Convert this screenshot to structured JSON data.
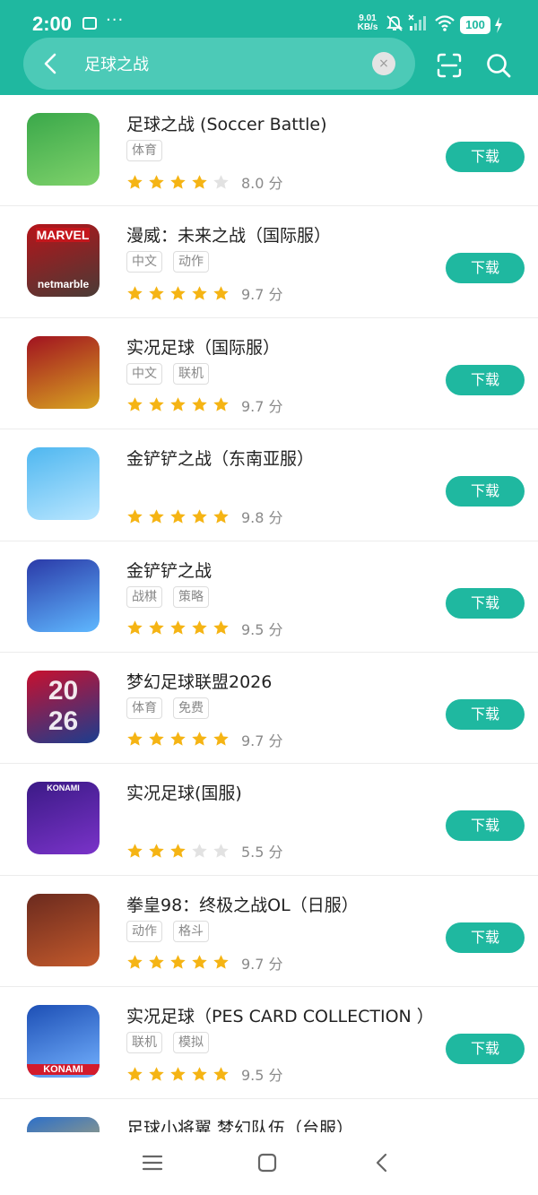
{
  "status_bar": {
    "time": "2:00",
    "dots": "···",
    "speed_value": "9.01",
    "speed_unit": "KB/s",
    "battery": "100"
  },
  "search": {
    "value": "足球之战",
    "clear_glyph": "×"
  },
  "apps": [
    {
      "name": "足球之战 (Soccer Battle)",
      "tags": [
        "体育"
      ],
      "stars": 4,
      "score": "8.0 分",
      "download_label": "下载",
      "icon": "soccer-battle-icon",
      "icon_colors": [
        "#3aa84a",
        "#7fd26b"
      ]
    },
    {
      "name": "漫威：未来之战（国际服）",
      "tags": [
        "中文",
        "动作"
      ],
      "stars": 5,
      "score": "9.7 分",
      "download_label": "下载",
      "icon": "marvel-future-fight-icon",
      "icon_colors": [
        "#b5141a",
        "#4a3b36"
      ]
    },
    {
      "name": "实况足球（国际服）",
      "tags": [
        "中文",
        "联机"
      ],
      "stars": 5,
      "score": "9.7 分",
      "download_label": "下载",
      "icon": "efootball-global-icon",
      "icon_colors": [
        "#a11220",
        "#d8a521"
      ]
    },
    {
      "name": "金铲铲之战（东南亚服）",
      "tags": [],
      "stars": 5,
      "score": "9.8 分",
      "download_label": "下载",
      "icon": "penguin-sea-icon",
      "icon_colors": [
        "#4fb7f0",
        "#b9e6ff"
      ]
    },
    {
      "name": "金铲铲之战",
      "tags": [
        "战棋",
        "策略"
      ],
      "stars": 5,
      "score": "9.5 分",
      "download_label": "下载",
      "icon": "penguin-cn-icon",
      "icon_colors": [
        "#2b3aa8",
        "#5fb8ff"
      ]
    },
    {
      "name": "梦幻足球联盟2026",
      "tags": [
        "体育",
        "免费"
      ],
      "stars": 5,
      "score": "9.7 分",
      "download_label": "下载",
      "icon": "dream-league-icon",
      "icon_colors": [
        "#c8102e",
        "#1b3d8f"
      ]
    },
    {
      "name": "实况足球(国服)",
      "tags": [],
      "stars": 3,
      "score": "5.5 分",
      "download_label": "下载",
      "icon": "efootball-cn-icon",
      "icon_colors": [
        "#3b1a86",
        "#7a33c9"
      ]
    },
    {
      "name": "拳皇98：终极之战OL（日服）",
      "tags": [
        "动作",
        "格斗"
      ],
      "stars": 5,
      "score": "9.7 分",
      "download_label": "下载",
      "icon": "kof98-icon",
      "icon_colors": [
        "#6b2a1e",
        "#c35a2c"
      ]
    },
    {
      "name": "实况足球（PES CARD COLLECTION ）",
      "tags": [
        "联机",
        "模拟"
      ],
      "stars": 5,
      "score": "9.5 分",
      "download_label": "下载",
      "icon": "pes-card-icon",
      "icon_colors": [
        "#1d4fb5",
        "#74b2ff"
      ]
    },
    {
      "name": "足球小将翼 梦幻队伍（台服）",
      "tags": [],
      "stars": 0,
      "score": "",
      "download_label": "",
      "icon": "captain-tsubasa-icon",
      "icon_colors": [
        "#2c6fc9",
        "#f0c24b"
      ]
    }
  ],
  "icon_text": {
    "marvel": "MARVEL",
    "netmarble": "netmarble",
    "konami": "KONAMI",
    "year_top": "20",
    "year_bottom": "26"
  },
  "colors": {
    "accent": "#1fb8a0",
    "star_on": "#f5b414",
    "star_off": "#e2e2e2"
  }
}
